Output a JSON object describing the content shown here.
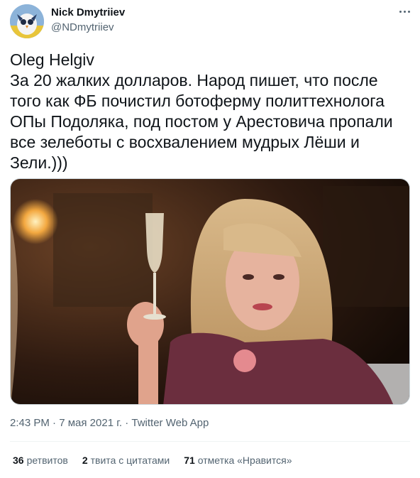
{
  "author": {
    "name": "Nick Dmytriiev",
    "handle": "@NDmytriiev"
  },
  "tweet": {
    "text": "Oleg Helgiv\nЗа 20 жалких долларов. Народ пишет, что после того как ФБ почистил ботоферму политтехнолога ОПы Подоляка, под постом у Арестовича пропали все зелеботы с восхвалением мудрых Лёши и Зели.)))"
  },
  "meta": {
    "time": "2:43 PM",
    "date": "7 мая 2021 г.",
    "source": "Twitter Web App",
    "separator": "·"
  },
  "stats": {
    "retweets_count": "36",
    "retweets_label": "ретвитов",
    "quotes_count": "2",
    "quotes_label": "твита с цитатами",
    "likes_count": "71",
    "likes_label": "отметка «Нравится»"
  },
  "colors": {
    "text_primary": "#0f1419",
    "text_secondary": "#536471",
    "divider": "#eff3f4"
  }
}
